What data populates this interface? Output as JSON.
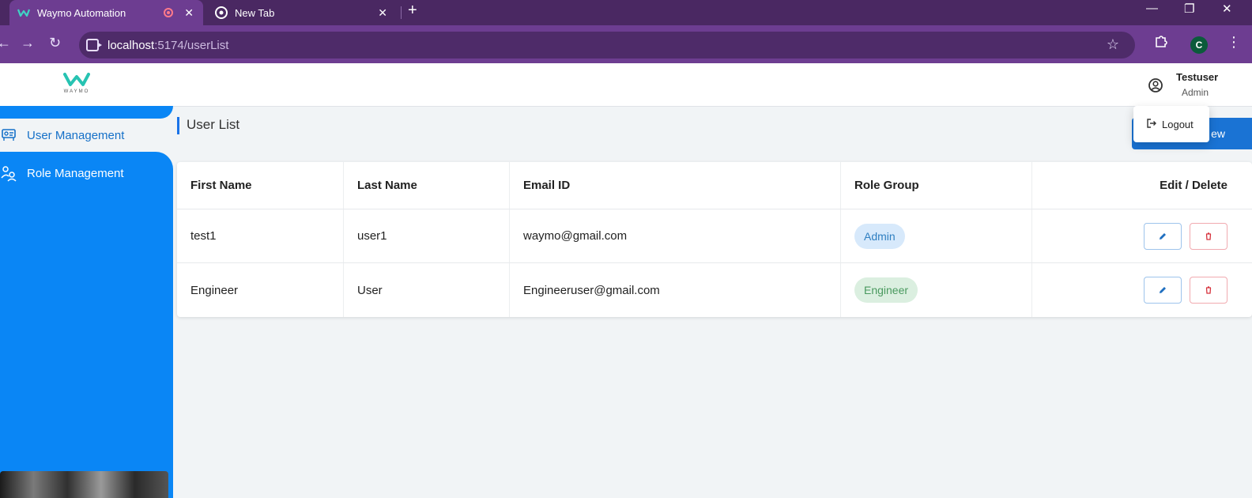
{
  "browser": {
    "tabs": [
      {
        "title": "Waymo Automation",
        "active": true
      },
      {
        "title": "New Tab",
        "active": false
      }
    ],
    "url_host": "localhost",
    "url_path": ":5174/userList",
    "profile_initial": "C"
  },
  "header": {
    "logo_word": "WAYMO",
    "user_name": "Testuser",
    "user_role": "Admin"
  },
  "menu": {
    "logout_label": "Logout"
  },
  "sidebar": {
    "items": [
      {
        "label": "User Management",
        "selected": true,
        "icon": "user-management-icon"
      },
      {
        "label": "Role Management",
        "selected": false,
        "icon": "role-management-icon"
      }
    ]
  },
  "main": {
    "title": "User List",
    "add_button_label": "ew"
  },
  "table": {
    "headers": [
      "First Name",
      "Last Name",
      "Email ID",
      "Role Group",
      "Edit / Delete"
    ],
    "rows": [
      {
        "first": "test1",
        "last": "user1",
        "email": "waymo@gmail.com",
        "role": "Admin"
      },
      {
        "first": "Engineer",
        "last": "User",
        "email": "Engineeruser@gmail.com",
        "role": "Engineer"
      }
    ]
  },
  "colors": {
    "browser_frame": "#4a2862",
    "browser_toolbar": "#6d3d91",
    "sidebar": "#0a86f5",
    "accent": "#1a73d4",
    "admin_badge": "#d7e9fb",
    "engineer_badge": "#dbefe0"
  }
}
